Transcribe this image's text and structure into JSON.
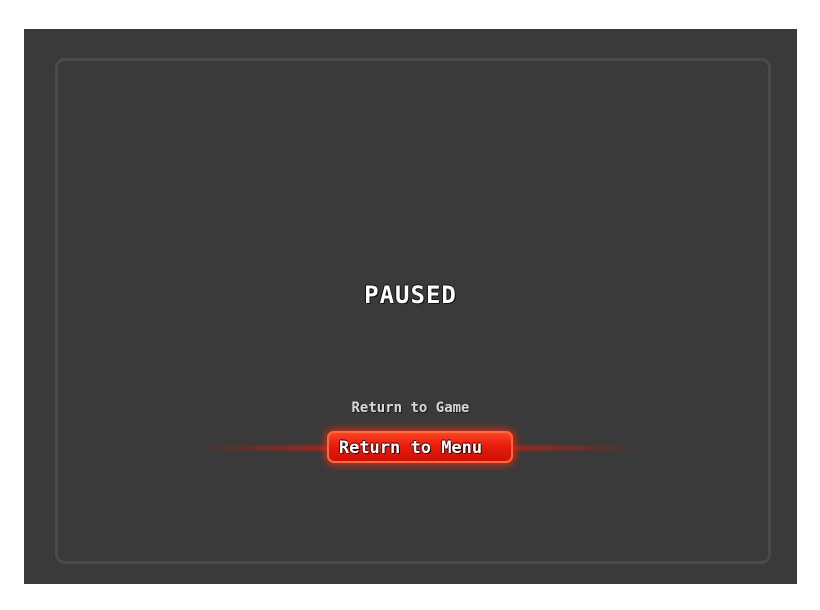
{
  "pause_menu": {
    "title": "PAUSED",
    "items": [
      {
        "label": "Return to Game",
        "selected": false
      },
      {
        "label": "Return to Menu",
        "selected": true
      }
    ]
  },
  "colors": {
    "background": "#3a3a3a",
    "frame_border": "#4a4a4a",
    "selected_highlight": "#e81d0c",
    "text": "#ffffff"
  }
}
